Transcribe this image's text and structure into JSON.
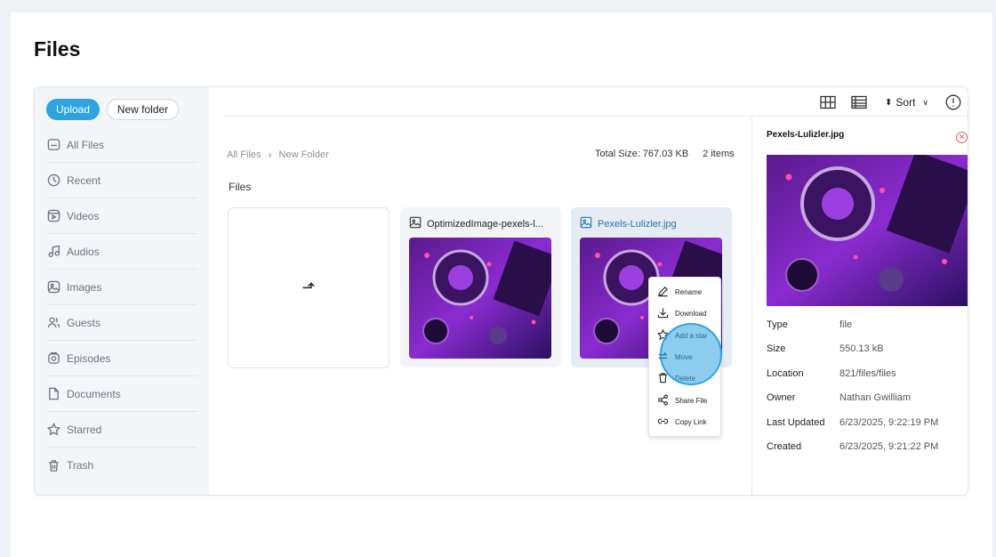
{
  "page": {
    "title": "Files"
  },
  "sidebar": {
    "upload_label": "Upload",
    "new_folder_label": "New folder",
    "items": [
      {
        "label": "All Files",
        "icon": "folder-icon"
      },
      {
        "label": "Recent",
        "icon": "clock-icon"
      },
      {
        "label": "Videos",
        "icon": "video-icon"
      },
      {
        "label": "Audios",
        "icon": "music-icon"
      },
      {
        "label": "Images",
        "icon": "image-icon"
      },
      {
        "label": "Guests",
        "icon": "users-icon"
      },
      {
        "label": "Episodes",
        "icon": "podcast-icon"
      },
      {
        "label": "Documents",
        "icon": "document-icon"
      },
      {
        "label": "Starred",
        "icon": "star-icon"
      },
      {
        "label": "Trash",
        "icon": "trash-icon"
      }
    ]
  },
  "toolbar": {
    "sort_label": "Sort"
  },
  "breadcrumb": {
    "root": "All Files",
    "current": "New Folder"
  },
  "summary": {
    "total_size": "Total Size: 767.03 KB",
    "item_count": "2 items"
  },
  "files_section": {
    "title": "Files"
  },
  "files": [
    {
      "name": "OptimizedImage-pexels-l...",
      "icon": "image-icon"
    },
    {
      "name": "Pexels-Lulizler.jpg",
      "icon": "image-icon"
    }
  ],
  "context_menu": [
    {
      "label": "Rename",
      "icon": "pencil-icon"
    },
    {
      "label": "Download",
      "icon": "download-icon"
    },
    {
      "label": "Add a star",
      "icon": "star-icon"
    },
    {
      "label": "Move",
      "icon": "move-icon"
    },
    {
      "label": "Delete",
      "icon": "trash-icon"
    },
    {
      "label": "Share File",
      "icon": "share-icon"
    },
    {
      "label": "Copy Link",
      "icon": "link-icon"
    }
  ],
  "details": {
    "title": "Pexels-Lulizler.jpg",
    "rows": [
      {
        "key": "Type",
        "value": "file"
      },
      {
        "key": "Size",
        "value": "550.13 kB"
      },
      {
        "key": "Location",
        "value": "821/files/files"
      },
      {
        "key": "Owner",
        "value": "Nathan Gwilliam"
      },
      {
        "key": "Last Updated",
        "value": "6/23/2025, 9:22:19 PM"
      },
      {
        "key": "Created",
        "value": "6/23/2025, 9:21:22 PM"
      }
    ]
  },
  "colors": {
    "accent": "#2ea3e0",
    "sidebar_bg": "#f3f6f9",
    "close": "#e35d5d"
  }
}
